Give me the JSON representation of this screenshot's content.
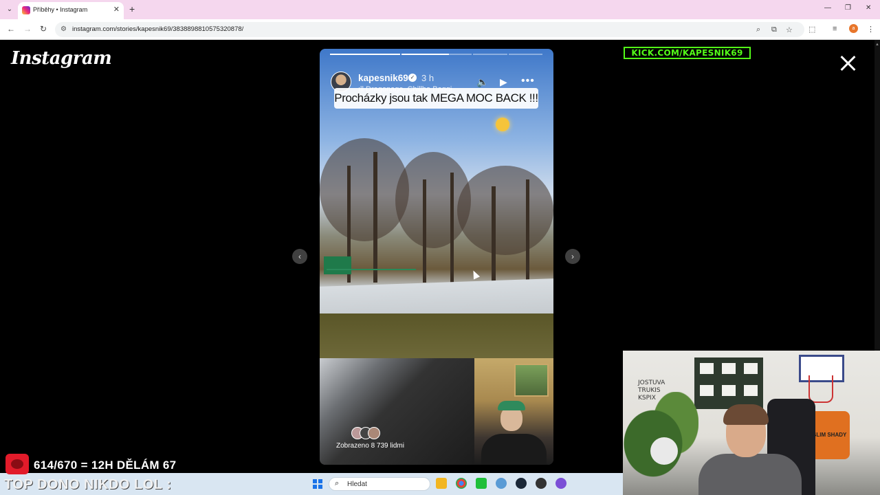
{
  "browser": {
    "tab_title": "Příběhy • Instagram",
    "url": "instagram.com/stories/kapesnik69/3838898810575320878/",
    "profile_initial": "a"
  },
  "page": {
    "logo": "Instagram",
    "kick_banner": "KICK.COM/KAPESNIK69"
  },
  "story": {
    "username": "kapesnik69",
    "time_ago": "3 h",
    "music": "Dragonage, Chillbo Baggi",
    "caption": "Procházky jsou tak MEGA MOC BACK !!!",
    "seen_by": "Zobrazeno 8 739 lidmi",
    "progress_segments": [
      1,
      1,
      0,
      0
    ],
    "segment_count": 4
  },
  "stream_overlay": {
    "dono_progress": "614/670 = 12H DĚLÁM 67",
    "top_dono": "TOP DONO NIKDO LOL :",
    "webcam_shirt_text": "SLIM SHADY",
    "webcam_wall_text": "JOSTUVA\nTRUKIS\nKSPIX"
  },
  "taskbar": {
    "search_placeholder": "Hledat"
  },
  "colors": {
    "kick_green": "#53fc18",
    "tabbar_bg": "#f5d7ee",
    "taskbar_bg": "#d9e6f2"
  }
}
